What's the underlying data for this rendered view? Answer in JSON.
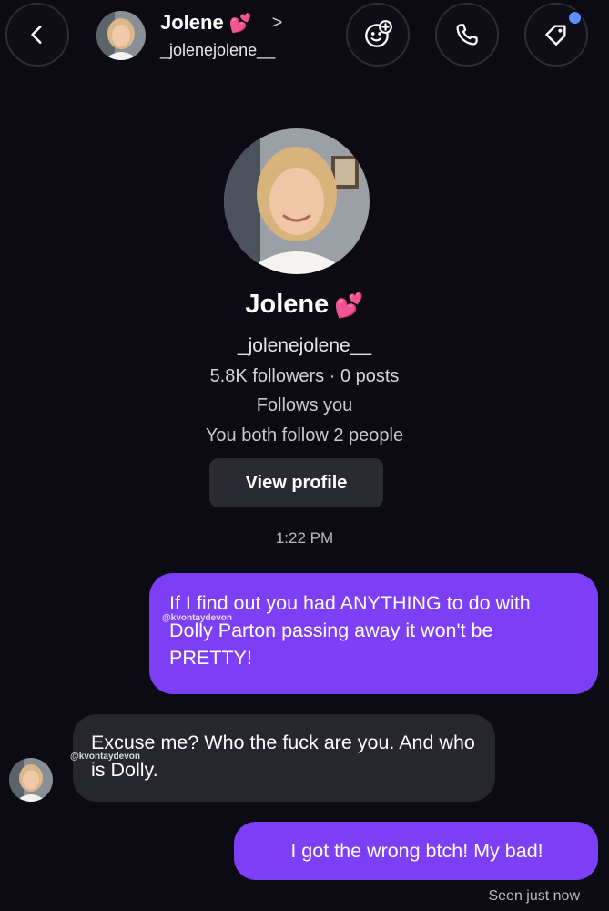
{
  "header": {
    "name": "Jolene",
    "name_emoji": "💕",
    "chevron": ">",
    "username": "_jolenejolene__"
  },
  "profile": {
    "name": "Jolene",
    "name_emoji": "💕",
    "username": "_jolenejolene__",
    "stats": "5.8K followers · 0 posts",
    "follows": "Follows you",
    "mutual": "You both follow 2 people",
    "view_button": "View profile"
  },
  "thread": {
    "timestamp": "1:22 PM",
    "messages": [
      {
        "from": "me",
        "text": "If I find out you had ANYTHING to do with Dolly Parton passing away it won't be PRETTY!"
      },
      {
        "from": "them",
        "text": "Excuse me? Who the fuck are you. And who is Dolly."
      },
      {
        "from": "me",
        "text": "I got the wrong btch! My bad!"
      }
    ],
    "watermark": "@kvontaydevon",
    "seen": "Seen just now"
  },
  "colors": {
    "background": "#0c0b14",
    "sent_bubble": "#7d3ff5",
    "received_bubble": "#26262e",
    "notification_dot": "#5b8dff"
  },
  "icons": [
    "back-arrow-icon",
    "effects-icon",
    "phone-icon",
    "tag-icon",
    "heart-emoji-icon"
  ]
}
